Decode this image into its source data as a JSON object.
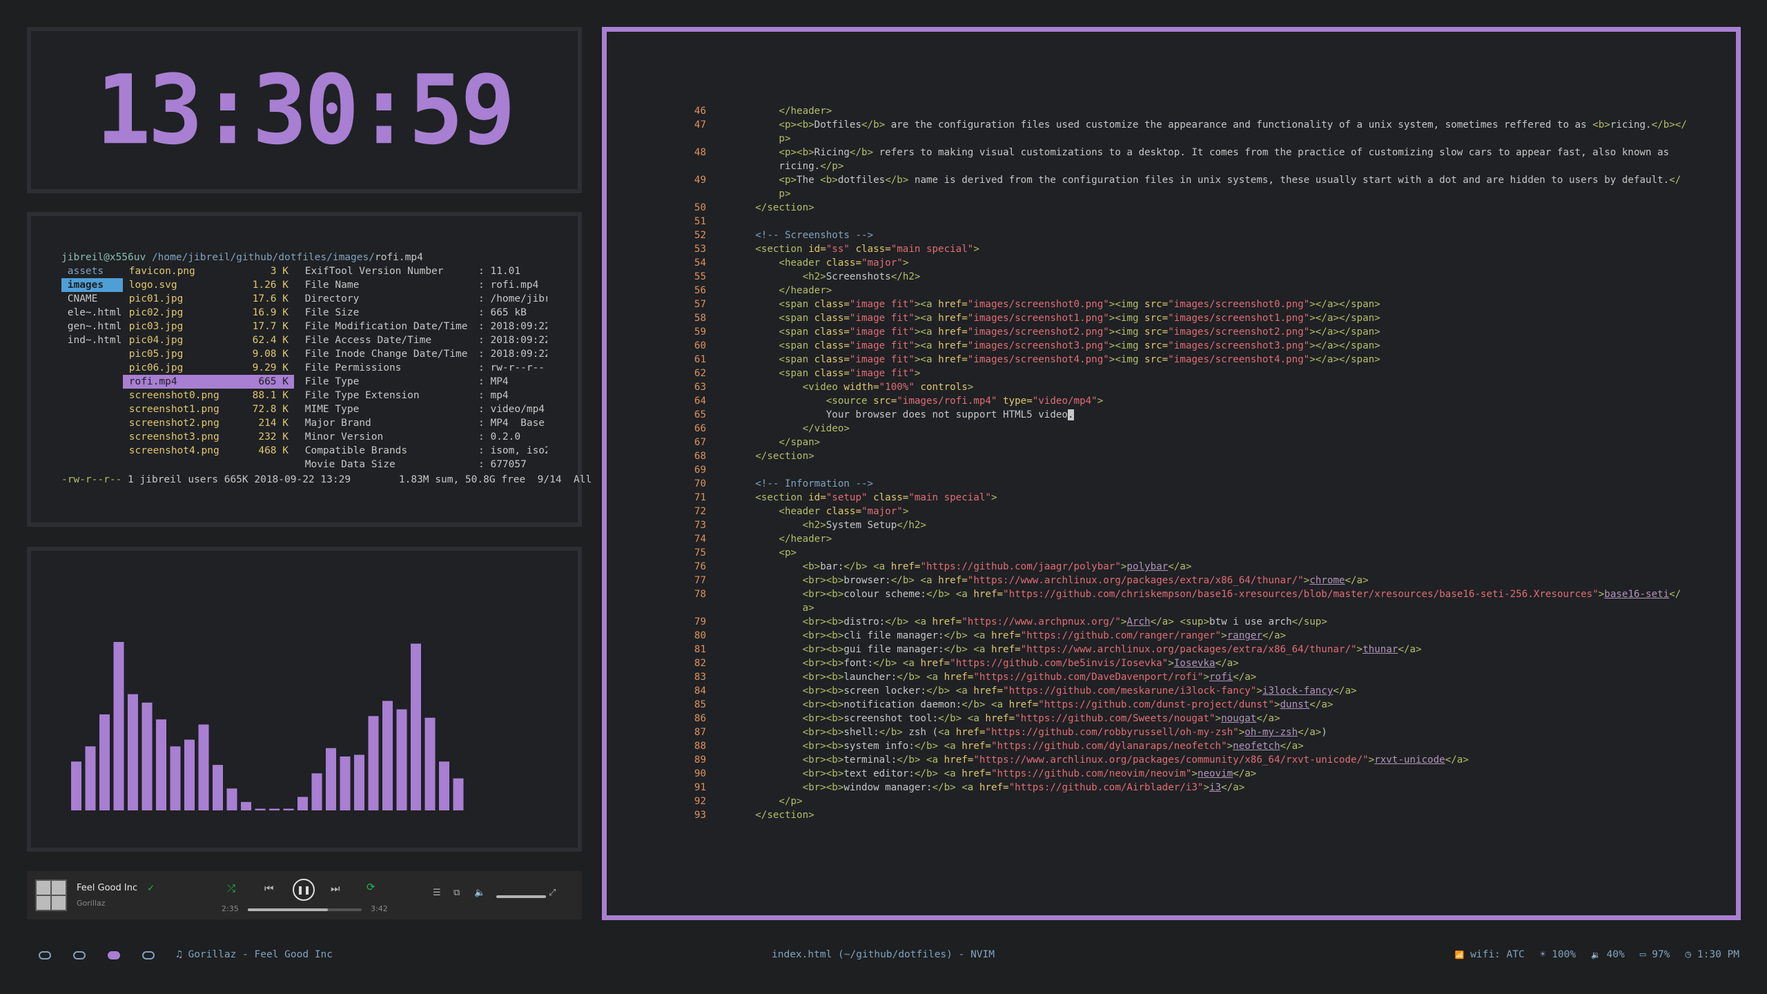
{
  "clock": {
    "time": "13:30:59"
  },
  "ranger": {
    "user": "jibreil@x556uv",
    "path": "/home/jibreil/github/dotfiles/images/",
    "file": "rofi.mp4",
    "parent_dirs": [
      "assets",
      "images",
      "CNAME",
      "ele~.html",
      "gen~.html",
      "ind~.html"
    ],
    "files": [
      {
        "name": "favicon.png",
        "size": "3 K"
      },
      {
        "name": "logo.svg",
        "size": "1.26 K"
      },
      {
        "name": "pic01.jpg",
        "size": "17.6 K"
      },
      {
        "name": "pic02.jpg",
        "size": "16.9 K"
      },
      {
        "name": "pic03.jpg",
        "size": "17.7 K"
      },
      {
        "name": "pic04.jpg",
        "size": "62.4 K"
      },
      {
        "name": "pic05.jpg",
        "size": "9.08 K"
      },
      {
        "name": "pic06.jpg",
        "size": "9.29 K"
      },
      {
        "name": "rofi.mp4",
        "size": "665 K"
      },
      {
        "name": "screenshot0.png",
        "size": "88.1 K"
      },
      {
        "name": "screenshot1.png",
        "size": "72.8 K"
      },
      {
        "name": "screenshot2.png",
        "size": "214 K"
      },
      {
        "name": "screenshot3.png",
        "size": "232 K"
      },
      {
        "name": "screenshot4.png",
        "size": "468 K"
      }
    ],
    "exif": [
      {
        "k": "ExifTool Version Number",
        "v": ": 11.01"
      },
      {
        "k": "File Name",
        "v": ": rofi.mp4"
      },
      {
        "k": "Directory",
        "v": ": /home/jibr"
      },
      {
        "k": "File Size",
        "v": ": 665 kB"
      },
      {
        "k": "File Modification Date/Time",
        "v": ": 2018:09:22"
      },
      {
        "k": "File Access Date/Time",
        "v": ": 2018:09:22"
      },
      {
        "k": "File Inode Change Date/Time",
        "v": ": 2018:09:22"
      },
      {
        "k": "File Permissions",
        "v": ": rw-r--r--"
      },
      {
        "k": "File Type",
        "v": ": MP4"
      },
      {
        "k": "File Type Extension",
        "v": ": mp4"
      },
      {
        "k": "MIME Type",
        "v": ": video/mp4"
      },
      {
        "k": "Major Brand",
        "v": ": MP4  Base"
      },
      {
        "k": "Minor Version",
        "v": ": 0.2.0"
      },
      {
        "k": "Compatible Brands",
        "v": ": isom, iso2"
      },
      {
        "k": "Movie Data Size",
        "v": ": 677057"
      }
    ],
    "status_perm": "-rw-r--r--",
    "status_rest": " 1 jibreil users 665K 2018-09-22 13:29        1.83M sum, 50.8G free  9/14  All"
  },
  "visualizer": {
    "levels": [
      0.29,
      0.38,
      0.57,
      1.0,
      0.69,
      0.64,
      0.54,
      0.38,
      0.42,
      0.51,
      0.27,
      0.13,
      0.05,
      0.01,
      0.01,
      0.01,
      0.08,
      0.22,
      0.37,
      0.32,
      0.33,
      0.56,
      0.65,
      0.6,
      0.99,
      0.55,
      0.29,
      0.19
    ]
  },
  "spotify": {
    "title": "Feel Good Inc",
    "artist": "Gorillaz",
    "elapsed": "2:35",
    "duration": "3:42",
    "progress": 0.7,
    "shuffle_icon": "⤮",
    "prev_icon": "⏮",
    "play_icon": "❚❚",
    "next_icon": "⏭",
    "repeat_icon": "⟳",
    "queue_icon": "☰",
    "devices_icon": "⧉",
    "volume_icon": "🔈",
    "fullscreen_icon": "⤢",
    "check_icon": "✓"
  },
  "nvim": {
    "lines": [
      {
        "n": "46",
        "h": "<span class='w'>          </span><span class='t'>&lt;/header&gt;</span>"
      },
      {
        "n": "47",
        "h": "<span class='w'>          </span><span class='t'>&lt;p&gt;&lt;b&gt;</span><span class='w'>Dotfiles</span><span class='t'>&lt;/b&gt;</span><span class='w'> are the configuration files used customize the appearance and functionality of a unix system, sometimes reffered to as </span><span class='t'>&lt;b&gt;</span><span class='w'>ricing.</span><span class='t'>&lt;/b&gt;&lt;/</span>"
      },
      {
        "n": "",
        "h": "<span class='t'>          p&gt;</span>"
      },
      {
        "n": "48",
        "h": "<span class='w'>          </span><span class='t'>&lt;p&gt;&lt;b&gt;</span><span class='w'>Ricing</span><span class='t'>&lt;/b&gt;</span><span class='w'> refers to making visual customizations to a desktop. It comes from the practice of customizing slow cars to appear fast, also known as</span>"
      },
      {
        "n": "",
        "h": "<span class='w'>          ricing.</span><span class='t'>&lt;/p&gt;</span>"
      },
      {
        "n": "49",
        "h": "<span class='w'>          </span><span class='t'>&lt;p&gt;</span><span class='w'>The </span><span class='t'>&lt;b&gt;</span><span class='w'>dotfiles</span><span class='t'>&lt;/b&gt;</span><span class='w'> name is derived from the configuration files in unix systems, these usually start with a dot and are hidden to users by default.</span><span class='t'>&lt;/</span>"
      },
      {
        "n": "",
        "h": "<span class='t'>          p&gt;</span>"
      },
      {
        "n": "50",
        "h": "<span class='w'>      </span><span class='t'>&lt;/section&gt;</span>"
      },
      {
        "n": "51",
        "h": ""
      },
      {
        "n": "52",
        "h": "<span class='w'>      </span><span class='c'>&lt;!-- Screenshots --&gt;</span>"
      },
      {
        "n": "53",
        "h": "<span class='w'>      </span><span class='t'>&lt;section </span><span class='a'>id=</span><span class='s'>\"ss\"</span><span class='a'> class=</span><span class='s'>\"main special\"</span><span class='t'>&gt;</span>"
      },
      {
        "n": "54",
        "h": "<span class='w'>          </span><span class='t'>&lt;header </span><span class='a'>class=</span><span class='s'>\"major\"</span><span class='t'>&gt;</span>"
      },
      {
        "n": "55",
        "h": "<span class='w'>              </span><span class='t'>&lt;h2&gt;</span><span class='w'>Screenshots</span><span class='t'>&lt;/h2&gt;</span>"
      },
      {
        "n": "56",
        "h": "<span class='w'>          </span><span class='t'>&lt;/header&gt;</span>"
      },
      {
        "n": "57",
        "h": "<span class='w'>          </span><span class='t'>&lt;span </span><span class='a'>class=</span><span class='s'>\"image fit\"</span><span class='t'>&gt;&lt;a </span><span class='a'>href=</span><span class='s'>\"images/screenshot0.png\"</span><span class='t'>&gt;&lt;img </span><span class='a'>src=</span><span class='s'>\"images/screenshot0.png\"</span><span class='t'>&gt;&lt;/a&gt;&lt;/span&gt;</span>"
      },
      {
        "n": "58",
        "h": "<span class='w'>          </span><span class='t'>&lt;span </span><span class='a'>class=</span><span class='s'>\"image fit\"</span><span class='t'>&gt;&lt;a </span><span class='a'>href=</span><span class='s'>\"images/screenshot1.png\"</span><span class='t'>&gt;&lt;img </span><span class='a'>src=</span><span class='s'>\"images/screenshot1.png\"</span><span class='t'>&gt;&lt;/a&gt;&lt;/span&gt;</span>"
      },
      {
        "n": "59",
        "h": "<span class='w'>          </span><span class='t'>&lt;span </span><span class='a'>class=</span><span class='s'>\"image fit\"</span><span class='t'>&gt;&lt;a </span><span class='a'>href=</span><span class='s'>\"images/screenshot2.png\"</span><span class='t'>&gt;&lt;img </span><span class='a'>src=</span><span class='s'>\"images/screenshot2.png\"</span><span class='t'>&gt;&lt;/a&gt;&lt;/span&gt;</span>"
      },
      {
        "n": "60",
        "h": "<span class='w'>          </span><span class='t'>&lt;span </span><span class='a'>class=</span><span class='s'>\"image fit\"</span><span class='t'>&gt;&lt;a </span><span class='a'>href=</span><span class='s'>\"images/screenshot3.png\"</span><span class='t'>&gt;&lt;img </span><span class='a'>src=</span><span class='s'>\"images/screenshot3.png\"</span><span class='t'>&gt;&lt;/a&gt;&lt;/span&gt;</span>"
      },
      {
        "n": "61",
        "h": "<span class='w'>          </span><span class='t'>&lt;span </span><span class='a'>class=</span><span class='s'>\"image fit\"</span><span class='t'>&gt;&lt;a </span><span class='a'>href=</span><span class='s'>\"images/screenshot4.png\"</span><span class='t'>&gt;&lt;img </span><span class='a'>src=</span><span class='s'>\"images/screenshot4.png\"</span><span class='t'>&gt;&lt;/a&gt;&lt;/span&gt;</span>"
      },
      {
        "n": "62",
        "h": "<span class='w'>          </span><span class='t'>&lt;span </span><span class='a'>class=</span><span class='s'>\"image fit\"</span><span class='t'>&gt;</span>"
      },
      {
        "n": "63",
        "h": "<span class='w'>              </span><span class='t'>&lt;video </span><span class='a'>width=</span><span class='s'>\"100%\"</span><span class='a'> controls</span><span class='t'>&gt;</span>"
      },
      {
        "n": "64",
        "h": "<span class='w'>                  </span><span class='t'>&lt;source </span><span class='a'>src=</span><span class='s'>\"images/rofi.mp4\"</span><span class='a'> type=</span><span class='s'>\"video/mp4\"</span><span class='t'>&gt;</span>"
      },
      {
        "n": "65",
        "h": "<span class='w'>                  Your browser does not support HTML5 video</span><span class='cursor'>.</span>"
      },
      {
        "n": "66",
        "h": "<span class='w'>              </span><span class='t'>&lt;/video&gt;</span>"
      },
      {
        "n": "67",
        "h": "<span class='w'>          </span><span class='t'>&lt;/span&gt;</span>"
      },
      {
        "n": "68",
        "h": "<span class='w'>      </span><span class='t'>&lt;/section&gt;</span>"
      },
      {
        "n": "69",
        "h": ""
      },
      {
        "n": "70",
        "h": "<span class='w'>      </span><span class='c'>&lt;!-- Information --&gt;</span>"
      },
      {
        "n": "71",
        "h": "<span class='w'>      </span><span class='t'>&lt;section </span><span class='a'>id=</span><span class='s'>\"setup\"</span><span class='a'> class=</span><span class='s'>\"main special\"</span><span class='t'>&gt;</span>"
      },
      {
        "n": "72",
        "h": "<span class='w'>          </span><span class='t'>&lt;header </span><span class='a'>class=</span><span class='s'>\"major\"</span><span class='t'>&gt;</span>"
      },
      {
        "n": "73",
        "h": "<span class='w'>              </span><span class='t'>&lt;h2&gt;</span><span class='w'>System Setup</span><span class='t'>&lt;/h2&gt;</span>"
      },
      {
        "n": "74",
        "h": "<span class='w'>          </span><span class='t'>&lt;/header&gt;</span>"
      },
      {
        "n": "75",
        "h": "<span class='w'>          </span><span class='t'>&lt;p&gt;</span>"
      },
      {
        "n": "76",
        "h": "<span class='w'>              </span><span class='t'>&lt;b&gt;</span><span class='w'>bar:</span><span class='t'>&lt;/b&gt;</span><span class='w'> </span><span class='t'>&lt;a </span><span class='a'>href=</span><span class='s'>\"https://github.com/jaagr/polybar\"</span><span class='t'>&gt;</span><span class='u'>polybar</span><span class='t'>&lt;/a&gt;</span>"
      },
      {
        "n": "77",
        "h": "<span class='w'>              </span><span class='t'>&lt;br&gt;&lt;b&gt;</span><span class='w'>browser:</span><span class='t'>&lt;/b&gt;</span><span class='w'> </span><span class='t'>&lt;a </span><span class='a'>href=</span><span class='s'>\"https://www.archlinux.org/packages/extra/x86_64/thunar/\"</span><span class='t'>&gt;</span><span class='u'>chrome</span><span class='t'>&lt;/a&gt;</span>"
      },
      {
        "n": "78",
        "h": "<span class='w'>              </span><span class='t'>&lt;br&gt;&lt;b&gt;</span><span class='w'>colour scheme:</span><span class='t'>&lt;/b&gt;</span><span class='w'> </span><span class='t'>&lt;a </span><span class='a'>href=</span><span class='s'>\"https://github.com/chriskempson/base16-xresources/blob/master/xresources/base16-seti-256.Xresources\"</span><span class='t'>&gt;</span><span class='u'>base16-seti</span><span class='t'>&lt;/</span>"
      },
      {
        "n": "",
        "h": "<span class='t'>              a&gt;</span>"
      },
      {
        "n": "79",
        "h": "<span class='w'>              </span><span class='t'>&lt;br&gt;&lt;b&gt;</span><span class='w'>distro:</span><span class='t'>&lt;/b&gt;</span><span class='w'> </span><span class='t'>&lt;a </span><span class='a'>href=</span><span class='s'>\"https://www.archpnux.org/\"</span><span class='t'>&gt;</span><span class='u'>Arch</span><span class='t'>&lt;/a&gt;</span><span class='w'> </span><span class='t'>&lt;sup&gt;</span><span class='w'>btw i use arch</span><span class='t'>&lt;/sup&gt;</span>"
      },
      {
        "n": "80",
        "h": "<span class='w'>              </span><span class='t'>&lt;br&gt;&lt;b&gt;</span><span class='w'>cli file manager:</span><span class='t'>&lt;/b&gt;</span><span class='w'> </span><span class='t'>&lt;a </span><span class='a'>href=</span><span class='s'>\"https://github.com/ranger/ranger\"</span><span class='t'>&gt;</span><span class='u'>ranger</span><span class='t'>&lt;/a&gt;</span>"
      },
      {
        "n": "81",
        "h": "<span class='w'>              </span><span class='t'>&lt;br&gt;&lt;b&gt;</span><span class='w'>gui file manager:</span><span class='t'>&lt;/b&gt;</span><span class='w'> </span><span class='t'>&lt;a </span><span class='a'>href=</span><span class='s'>\"https://www.archlinux.org/packages/extra/x86_64/thunar/\"</span><span class='t'>&gt;</span><span class='u'>thunar</span><span class='t'>&lt;/a&gt;</span>"
      },
      {
        "n": "82",
        "h": "<span class='w'>              </span><span class='t'>&lt;br&gt;&lt;b&gt;</span><span class='w'>font:</span><span class='t'>&lt;/b&gt;</span><span class='w'> </span><span class='t'>&lt;a </span><span class='a'>href=</span><span class='s'>\"https://github.com/be5invis/Iosevka\"</span><span class='t'>&gt;</span><span class='u'>Iosevka</span><span class='t'>&lt;/a&gt;</span>"
      },
      {
        "n": "83",
        "h": "<span class='w'>              </span><span class='t'>&lt;br&gt;&lt;b&gt;</span><span class='w'>launcher:</span><span class='t'>&lt;/b&gt;</span><span class='w'> </span><span class='t'>&lt;a </span><span class='a'>href=</span><span class='s'>\"https://github.com/DaveDavenport/rofi\"</span><span class='t'>&gt;</span><span class='u'>rofi</span><span class='t'>&lt;/a&gt;</span>"
      },
      {
        "n": "84",
        "h": "<span class='w'>              </span><span class='t'>&lt;br&gt;&lt;b&gt;</span><span class='w'>screen locker:</span><span class='t'>&lt;/b&gt;</span><span class='w'> </span><span class='t'>&lt;a </span><span class='a'>href=</span><span class='s'>\"https://github.com/meskarune/i3lock-fancy\"</span><span class='t'>&gt;</span><span class='u'>i3lock-fancy</span><span class='t'>&lt;/a&gt;</span>"
      },
      {
        "n": "85",
        "h": "<span class='w'>              </span><span class='t'>&lt;br&gt;&lt;b&gt;</span><span class='w'>notification daemon:</span><span class='t'>&lt;/b&gt;</span><span class='w'> </span><span class='t'>&lt;a </span><span class='a'>href=</span><span class='s'>\"https://github.com/dunst-project/dunst\"</span><span class='t'>&gt;</span><span class='u'>dunst</span><span class='t'>&lt;/a&gt;</span>"
      },
      {
        "n": "86",
        "h": "<span class='w'>              </span><span class='t'>&lt;br&gt;&lt;b&gt;</span><span class='w'>screenshot tool:</span><span class='t'>&lt;/b&gt;</span><span class='w'> </span><span class='t'>&lt;a </span><span class='a'>href=</span><span class='s'>\"https://github.com/Sweets/nougat\"</span><span class='t'>&gt;</span><span class='u'>nougat</span><span class='t'>&lt;/a&gt;</span>"
      },
      {
        "n": "87",
        "h": "<span class='w'>              </span><span class='t'>&lt;br&gt;&lt;b&gt;</span><span class='w'>shell:</span><span class='t'>&lt;/b&gt;</span><span class='w'> zsh (</span><span class='t'>&lt;a </span><span class='a'>href=</span><span class='s'>\"https://github.com/robbyrussell/oh-my-zsh\"</span><span class='t'>&gt;</span><span class='u'>oh-my-zsh</span><span class='t'>&lt;/a&gt;</span><span class='w'>)</span>"
      },
      {
        "n": "88",
        "h": "<span class='w'>              </span><span class='t'>&lt;br&gt;&lt;b&gt;</span><span class='w'>system info:</span><span class='t'>&lt;/b&gt;</span><span class='w'> </span><span class='t'>&lt;a </span><span class='a'>href=</span><span class='s'>\"https://github.com/dylanaraps/neofetch\"</span><span class='t'>&gt;</span><span class='u'>neofetch</span><span class='t'>&lt;/a&gt;</span>"
      },
      {
        "n": "89",
        "h": "<span class='w'>              </span><span class='t'>&lt;br&gt;&lt;b&gt;</span><span class='w'>terminal:</span><span class='t'>&lt;/b&gt;</span><span class='w'> </span><span class='t'>&lt;a </span><span class='a'>href=</span><span class='s'>\"https://www.archlinux.org/packages/community/x86_64/rxvt-unicode/\"</span><span class='t'>&gt;</span><span class='u'>rxvt-unicode</span><span class='t'>&lt;/a&gt;</span>"
      },
      {
        "n": "90",
        "h": "<span class='w'>              </span><span class='t'>&lt;br&gt;&lt;b&gt;</span><span class='w'>text editor:</span><span class='t'>&lt;/b&gt;</span><span class='w'> </span><span class='t'>&lt;a </span><span class='a'>href=</span><span class='s'>\"https://github.com/neovim/neovim\"</span><span class='t'>&gt;</span><span class='u'>neovim</span><span class='t'>&lt;/a&gt;</span>"
      },
      {
        "n": "91",
        "h": "<span class='w'>              </span><span class='t'>&lt;br&gt;&lt;b&gt;</span><span class='w'>window manager:</span><span class='t'>&lt;/b&gt;</span><span class='w'> </span><span class='t'>&lt;a </span><span class='a'>href=</span><span class='s'>\"https://github.com/Airblader/i3\"</span><span class='t'>&gt;</span><span class='u'>i3</span><span class='t'>&lt;/a&gt;</span>"
      },
      {
        "n": "92",
        "h": "<span class='w'>          </span><span class='t'>&lt;/p&gt;</span>"
      },
      {
        "n": "93",
        "h": "<span class='w'>      </span><span class='t'>&lt;/section&gt;</span>"
      }
    ]
  },
  "bar": {
    "music": "Gorillaz - Feel Good Inc",
    "music_icon": "♫",
    "window_title": "index.html (~/github/dotfiles) - NVIM",
    "wifi": "wifi: ATC",
    "brightness": "100%",
    "volume": "40%",
    "battery": "97%",
    "time": "1:30 PM",
    "wifi_icon": "📶",
    "brightness_icon": "☀",
    "volume_icon": "🔉",
    "battery_icon": "▭",
    "clock_icon": "◷"
  }
}
